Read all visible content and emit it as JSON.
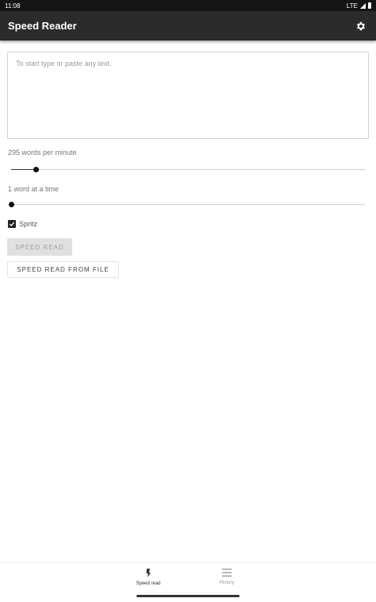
{
  "status_bar": {
    "time": "11:08",
    "network": "LTE"
  },
  "app_bar": {
    "title": "Speed Reader",
    "settings_icon": "gear-icon"
  },
  "editor": {
    "placeholder": "To start type or paste any text.",
    "value": ""
  },
  "wpm_slider": {
    "label": "295 words per minute",
    "fraction": 0.07
  },
  "words_slider": {
    "label": "1 word at a time",
    "fraction": 0.0
  },
  "spritz": {
    "label": "Spritz",
    "checked": true
  },
  "buttons": {
    "speed_read": "SPEED READ",
    "speed_read_from_file": "SPEED READ FROM FILE"
  },
  "bottom_nav": {
    "items": [
      {
        "label": "Speed read",
        "icon": "reader-icon",
        "active": true
      },
      {
        "label": "History",
        "icon": "list-icon",
        "active": false
      }
    ]
  },
  "colors": {
    "status_bar": "#151515",
    "app_bar": "#2b2b2b",
    "accent": "#111111",
    "disabled_button": "#e0e0e0"
  }
}
